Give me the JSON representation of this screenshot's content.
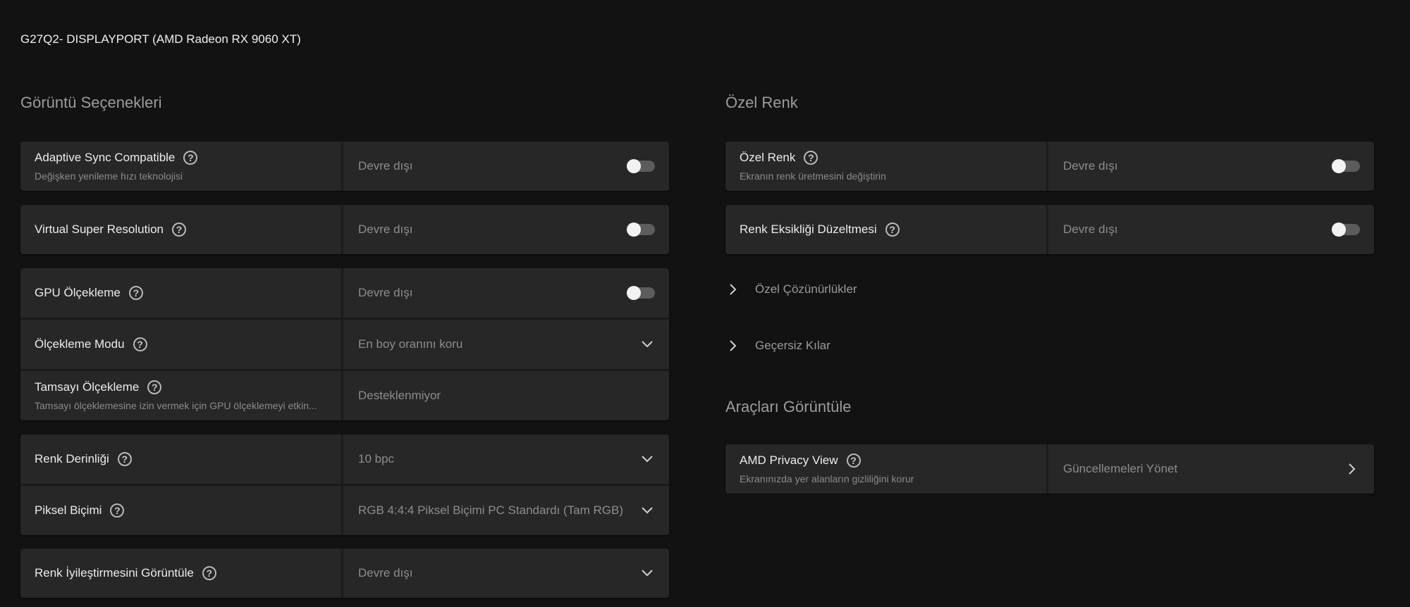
{
  "display": {
    "name": "G27Q2- DISPLAYPORT (AMD Radeon RX 9060 XT)"
  },
  "display_options": {
    "title": "Görüntü Seçenekleri",
    "adaptive_sync": {
      "label": "Adaptive Sync Compatible",
      "subtitle": "Değişken yenileme hızı teknolojisi",
      "value": "Devre dışı"
    },
    "vsr": {
      "label": "Virtual Super Resolution",
      "value": "Devre dışı"
    },
    "gpu_scaling": {
      "label": "GPU Ölçekleme",
      "value": "Devre dışı"
    },
    "scaling_mode": {
      "label": "Ölçekleme Modu",
      "value": "En boy oranını koru"
    },
    "integer_scaling": {
      "label": "Tamsayı Ölçekleme",
      "subtitle": "Tamsayı ölçeklemesine izin vermek için GPU ölçeklemeyi etkin...",
      "value": "Desteklenmiyor"
    },
    "color_depth": {
      "label": "Renk Derinliği",
      "value": "10 bpc"
    },
    "pixel_format": {
      "label": "Piksel Biçimi",
      "value": "RGB 4:4:4 Piksel Biçimi PC Standardı (Tam RGB)"
    },
    "color_enhancement": {
      "label": "Renk İyileştirmesini Görüntüle",
      "value": "Devre dışı"
    }
  },
  "custom_color": {
    "title": "Özel Renk",
    "custom_color_row": {
      "label": "Özel Renk",
      "subtitle": "Ekranın renk üretmesini değiştirin",
      "value": "Devre dışı"
    },
    "color_deficiency": {
      "label": "Renk Eksikliği Düzeltmesi",
      "value": "Devre dışı"
    },
    "custom_resolutions": "Özel Çözünürlükler",
    "overrides": "Geçersiz Kılar"
  },
  "display_tools": {
    "title": "Araçları Görüntüle",
    "privacy_view": {
      "label": "AMD Privacy View",
      "subtitle": "Ekranınızda yer alanların gizliliğini korur",
      "value": "Güncellemeleri Yönet"
    }
  },
  "icons": {
    "help": "?"
  },
  "colors": {
    "accent": "#b3142a",
    "background": "#121212",
    "card": "#272727"
  }
}
